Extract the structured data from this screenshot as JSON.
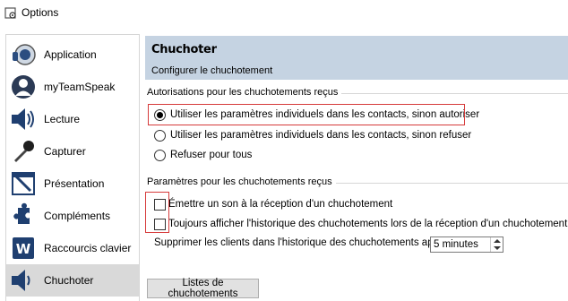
{
  "window": {
    "title": "Options"
  },
  "sidebar": {
    "items": [
      {
        "label": "Application",
        "icon": "teamspeak-icon"
      },
      {
        "label": "myTeamSpeak",
        "icon": "user-icon"
      },
      {
        "label": "Lecture",
        "icon": "speaker-icon"
      },
      {
        "label": "Capturer",
        "icon": "microphone-icon"
      },
      {
        "label": "Présentation",
        "icon": "presentation-icon"
      },
      {
        "label": "Compléments",
        "icon": "puzzle-icon"
      },
      {
        "label": "Raccourcis clavier",
        "icon": "keyboard-shortcut-icon"
      },
      {
        "label": "Chuchoter",
        "icon": "whisper-icon",
        "selected": true
      }
    ]
  },
  "main": {
    "header": {
      "title": "Chuchoter",
      "subtitle": "Configurer le chuchotement"
    },
    "permissions": {
      "title": "Autorisations pour les chuchotements reçus",
      "options": [
        {
          "label": "Utiliser les paramètres individuels dans les contacts, sinon autoriser",
          "checked": true
        },
        {
          "label": "Utiliser les paramètres individuels dans les contacts, sinon refuser",
          "checked": false
        },
        {
          "label": "Refuser pour tous",
          "checked": false
        }
      ]
    },
    "settings": {
      "title": "Paramètres pour les chuchotements reçus",
      "checkboxes": [
        {
          "label": "Émettre un son à la réception d'un chuchotement",
          "checked": false
        },
        {
          "label": "Toujours afficher l'historique des chuchotements lors de la réception d'un chuchotement",
          "checked": false
        }
      ],
      "remove_label": "Supprimer les clients dans l'historique des chuchotements après",
      "remove_value": "5 minutes"
    },
    "lists_button": "Listes de chuchotements"
  },
  "colors": {
    "header_bg": "#c5d3e2",
    "selected_bg": "#d9d9d9",
    "highlight": "#d63a3a"
  }
}
